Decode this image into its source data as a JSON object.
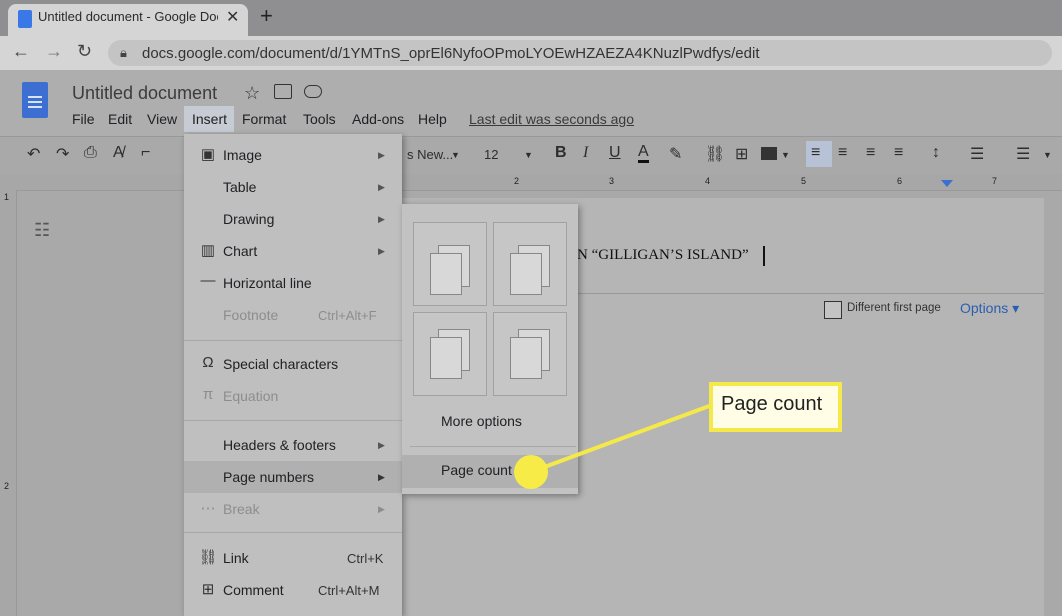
{
  "browser": {
    "tab_title": "Untitled document - Google Docs",
    "tab_close": "✕",
    "new_tab": "+",
    "url": "docs.google.com/document/d/1YMTnS_oprEl6NyfoOPmoLYOEwHZAEZA4KNuzlPwdfys/edit"
  },
  "docs": {
    "title": "Untitled document",
    "menu": [
      "File",
      "Edit",
      "View",
      "Insert",
      "Format",
      "Tools",
      "Add-ons",
      "Help"
    ],
    "last_edit": "Last edit was seconds ago",
    "toolbar": {
      "font_fragment": "s New...",
      "font_size": "12"
    },
    "ruler_numbers": [
      "1",
      "2",
      "3",
      "4",
      "5",
      "6",
      "7"
    ],
    "page_text": "N “GILLIGAN’S ISLAND”",
    "header_bar": {
      "different_first_page": "Different first page",
      "options": "Options"
    }
  },
  "insert_menu": {
    "items": [
      {
        "label": "Image",
        "icon": "image-icon",
        "arrow": true
      },
      {
        "label": "Table",
        "icon": "",
        "arrow": true
      },
      {
        "label": "Drawing",
        "icon": "",
        "arrow": true
      },
      {
        "label": "Chart",
        "icon": "chart-icon",
        "arrow": true
      },
      {
        "label": "Horizontal line",
        "icon": "horizontal-line-icon"
      },
      {
        "label": "Footnote",
        "shortcut": "Ctrl+Alt+F",
        "disabled": true
      },
      {
        "label": "Special characters",
        "icon": "omega-icon"
      },
      {
        "label": "Equation",
        "icon": "pi-icon",
        "disabled": true
      },
      {
        "label": "Headers & footers",
        "arrow": true
      },
      {
        "label": "Page numbers",
        "arrow": true,
        "highlighted": true
      },
      {
        "label": "Break",
        "icon": "break-icon",
        "arrow": true,
        "disabled": true
      },
      {
        "label": "Link",
        "icon": "link-icon",
        "shortcut": "Ctrl+K"
      },
      {
        "label": "Comment",
        "icon": "comment-icon",
        "shortcut": "Ctrl+Alt+M"
      }
    ]
  },
  "page_numbers_submenu": {
    "more_options": "More options",
    "page_count": "Page count"
  },
  "callout": {
    "text": "Page count",
    "color": "#f5e94a"
  }
}
